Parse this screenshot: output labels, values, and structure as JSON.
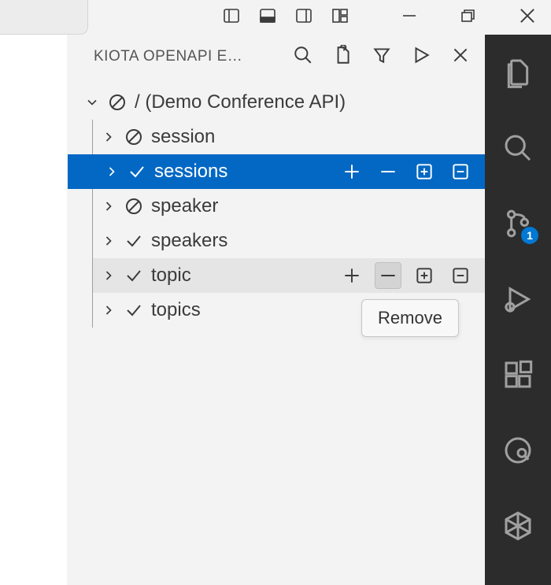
{
  "panel": {
    "title": "KIOTA OPENAPI EX…",
    "actions": {
      "search": "Search",
      "open": "Open",
      "filter": "Filter",
      "run": "Generate",
      "close": "Close"
    }
  },
  "tree": {
    "root": {
      "label": "/ (Demo Conference API)",
      "expanded": true,
      "status": "none"
    },
    "items": [
      {
        "label": "session",
        "status": "none",
        "state": ""
      },
      {
        "label": "sessions",
        "status": "check",
        "state": "selected"
      },
      {
        "label": "speaker",
        "status": "none",
        "state": ""
      },
      {
        "label": "speakers",
        "status": "check",
        "state": ""
      },
      {
        "label": "topic",
        "status": "check",
        "state": "hover"
      },
      {
        "label": "topics",
        "status": "check",
        "state": ""
      }
    ]
  },
  "row_actions": {
    "add": "Add",
    "remove": "Remove",
    "add_all": "Add all",
    "remove_all": "Remove all"
  },
  "tooltip": "Remove",
  "activitybar": {
    "badge": "1"
  }
}
